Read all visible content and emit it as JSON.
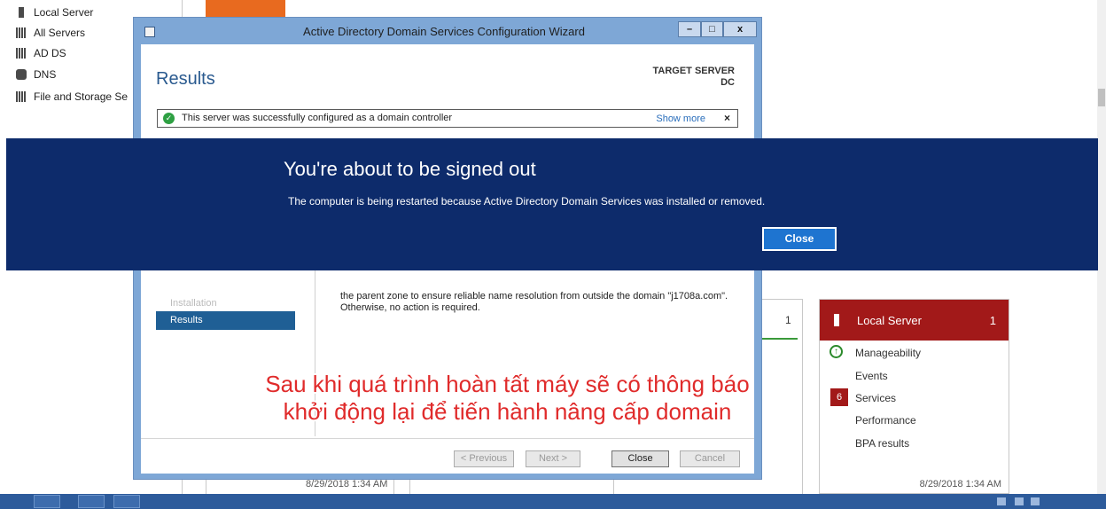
{
  "server_manager": {
    "nav": [
      {
        "label": "Local Server",
        "icon": "server-icon"
      },
      {
        "label": "All Servers",
        "icon": "servers-icon"
      },
      {
        "label": "AD DS",
        "icon": "ad-ds-icon"
      },
      {
        "label": "DNS",
        "icon": "dns-icon"
      },
      {
        "label": "File and Storage Se",
        "icon": "file-storage-icon"
      }
    ],
    "side_count": "1",
    "local_tile": {
      "title": "Local Server",
      "count": "1",
      "rows": [
        {
          "label": "Manageability",
          "badge": ""
        },
        {
          "label": "Events",
          "badge": ""
        },
        {
          "label": "Services",
          "badge": "6"
        },
        {
          "label": "Performance",
          "badge": ""
        },
        {
          "label": "BPA results",
          "badge": ""
        }
      ],
      "timestamp": "8/29/2018 1:34 AM"
    },
    "timestamp_left": "8/29/2018 1:34 AM"
  },
  "wizard": {
    "title": "Active Directory Domain Services Configuration Wizard",
    "controls": {
      "minimize": "–",
      "maximize": "□",
      "close": "x"
    },
    "heading": "Results",
    "target_server_label": "TARGET SERVER",
    "target_server_name": "DC",
    "success": {
      "message": "This server was successfully configured as a domain controller",
      "link": "Show more",
      "dismiss": "×"
    },
    "steps": [
      "Installation",
      "Results"
    ],
    "active_step": "Results",
    "detail_text": "the parent zone to ensure reliable name resolution from outside the domain \"j1708a.com\". Otherwise, no action is required.",
    "buttons": {
      "previous": "< Previous",
      "next": "Next >",
      "close": "Close",
      "cancel": "Cancel"
    }
  },
  "signout": {
    "title": "You're about to be signed out",
    "message": "The computer is being restarted because Active Directory Domain Services was installed or removed.",
    "button": "Close"
  },
  "caption": {
    "line1": "Sau khi quá trình hoàn tất máy sẽ có thông báo",
    "line2": "khởi động lại để tiến hành nâng cấp domain"
  },
  "colors": {
    "banner": "#0d2b6b",
    "banner_button": "#1e74d0",
    "tile_red": "#a21919",
    "caption_red": "#e02b2b",
    "wizard_frame": "#7ea7d6"
  }
}
